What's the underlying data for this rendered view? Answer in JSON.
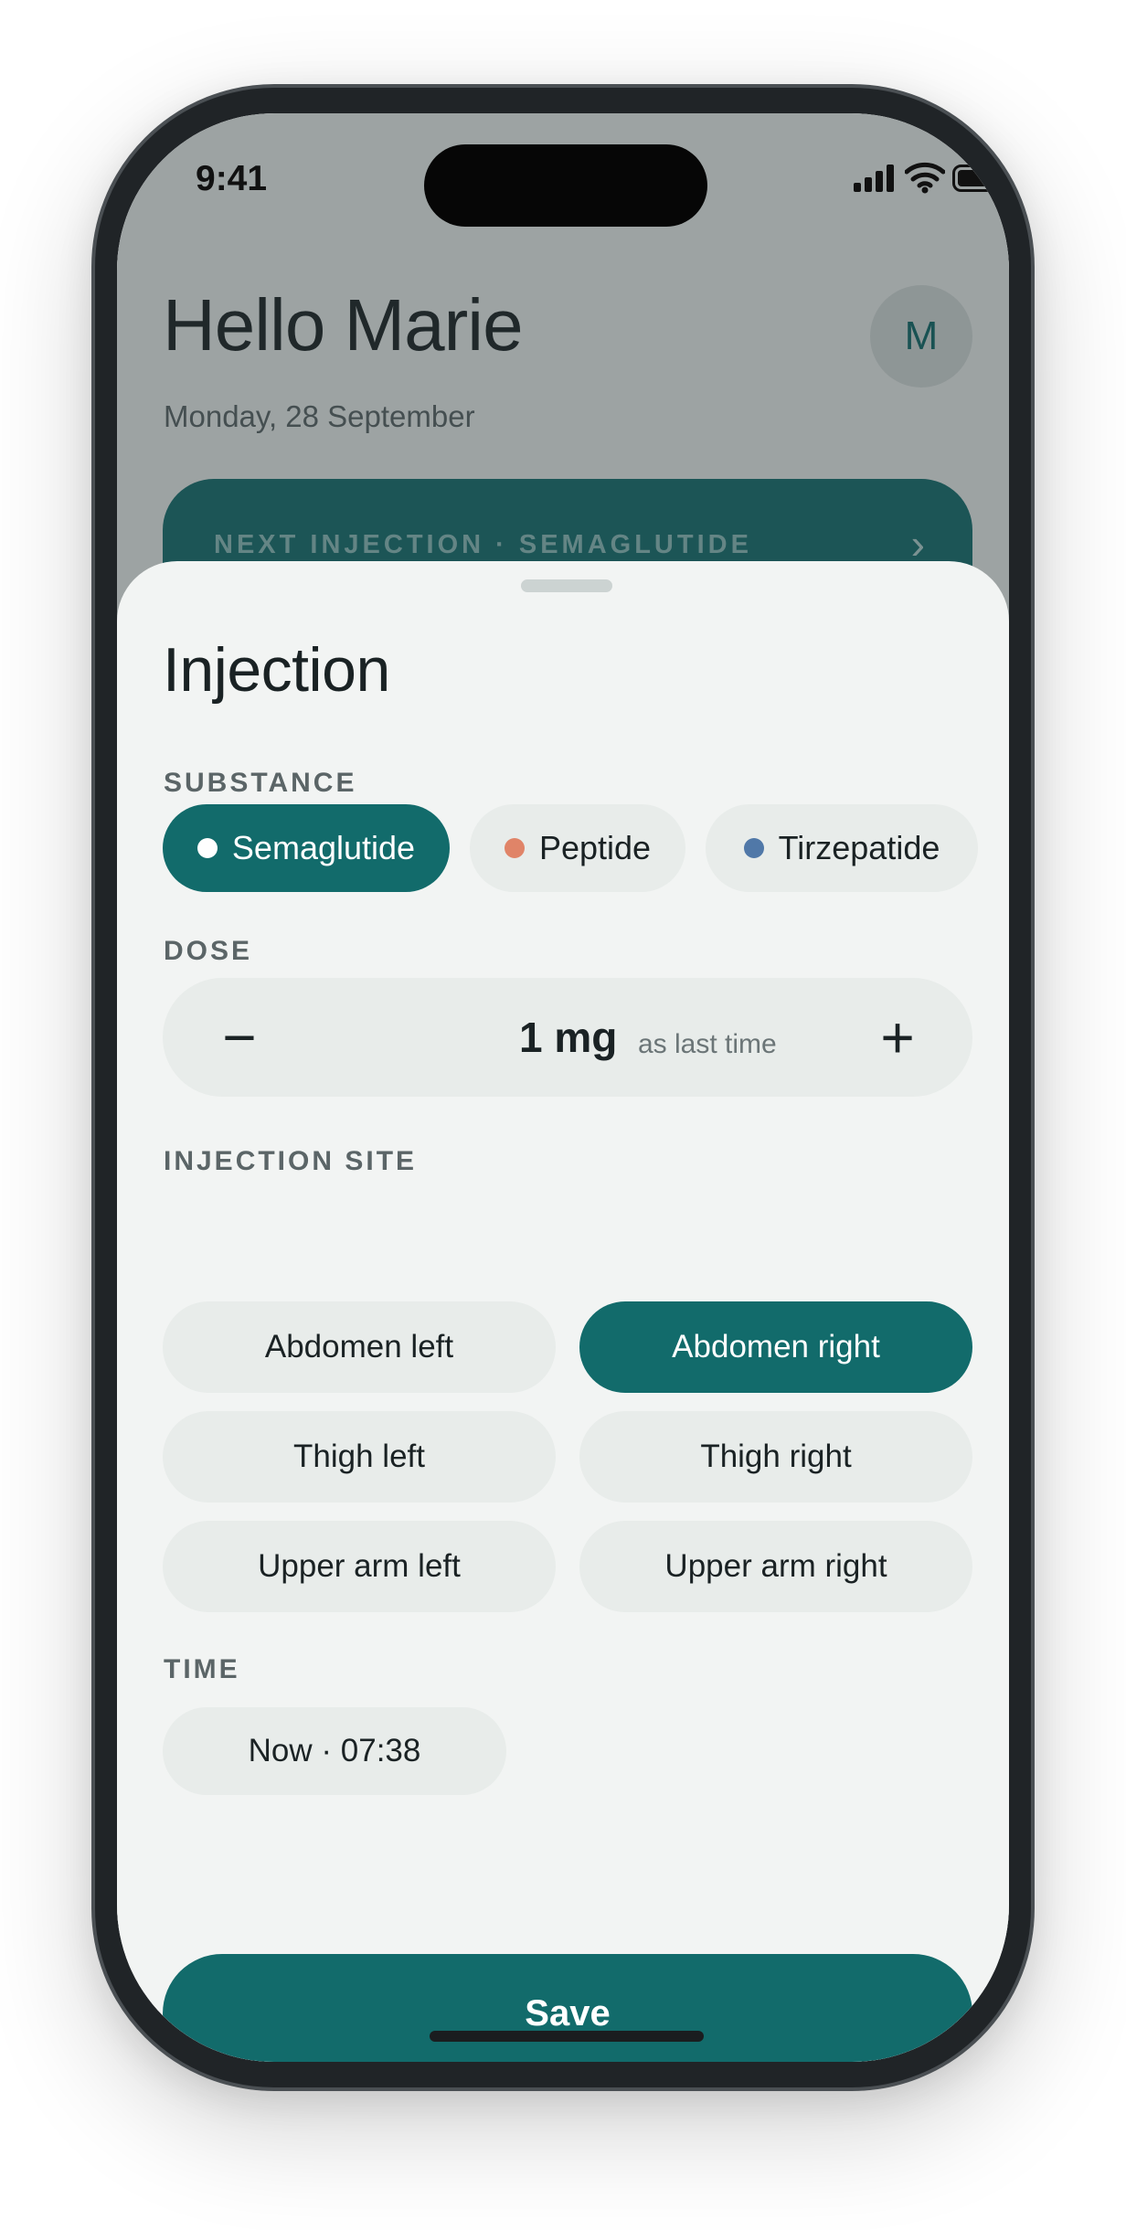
{
  "status_bar": {
    "time": "9:41",
    "icons": [
      "signal-icon",
      "wifi-icon",
      "battery-icon"
    ]
  },
  "home": {
    "greeting": "Hello Marie",
    "date": "Monday, 28 September",
    "avatar_initial": "M",
    "next_injection_label": "NEXT INJECTION · SEMAGLUTIDE",
    "next_injection_chevron": "›"
  },
  "sheet": {
    "title": "Injection",
    "substance": {
      "label": "SUBSTANCE",
      "options": [
        {
          "label": "Semaglutide",
          "dot_color": "#ffffff",
          "selected": true
        },
        {
          "label": "Peptide",
          "dot_color": "#e08468",
          "selected": false
        },
        {
          "label": "Tirzepatide",
          "dot_color": "#5078a8",
          "selected": false
        }
      ]
    },
    "dose": {
      "label": "DOSE",
      "value": "1 mg",
      "note": "as last time",
      "decrement_symbol": "−",
      "increment_symbol": "+"
    },
    "injection_site": {
      "label": "INJECTION SITE",
      "options": [
        {
          "label": "Abdomen left",
          "selected": false
        },
        {
          "label": "Abdomen right",
          "selected": true
        },
        {
          "label": "Thigh left",
          "selected": false
        },
        {
          "label": "Thigh right",
          "selected": false
        },
        {
          "label": "Upper arm left",
          "selected": false
        },
        {
          "label": "Upper arm right",
          "selected": false
        }
      ]
    },
    "time": {
      "label": "TIME",
      "value": "Now · 07:38"
    },
    "save_label": "Save"
  },
  "colors": {
    "accent": "#126b6b",
    "chip_background": "#e8ecea",
    "sheet_background": "#f2f4f3"
  }
}
